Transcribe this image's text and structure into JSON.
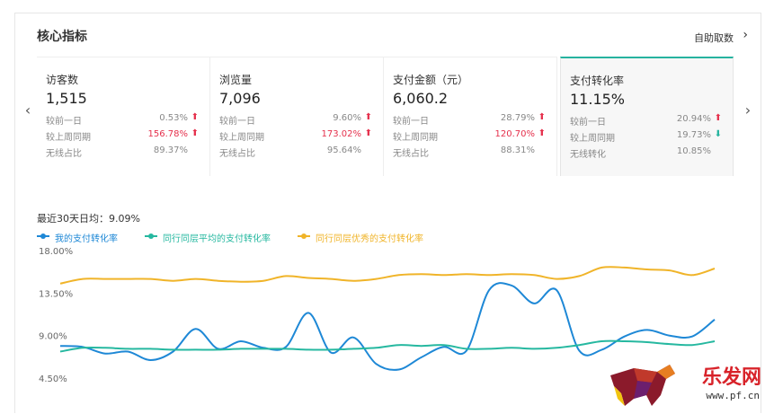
{
  "header": {
    "title": "核心指标",
    "self_fetch_label": "自助取数",
    "chevron_icon": "chevron-right-icon"
  },
  "nav": {
    "prev_icon": "chevron-left-icon",
    "next_icon": "chevron-right-icon",
    "prev_glyph": "‹",
    "next_glyph": "›"
  },
  "kpis": [
    {
      "name": "访客数",
      "value": "1,515",
      "rows": [
        {
          "label": "较前一日",
          "value": "0.53%",
          "trend": "up",
          "highlight": false
        },
        {
          "label": "较上周同期",
          "value": "156.78%",
          "trend": "up",
          "highlight": true
        },
        {
          "label": "无线占比",
          "value": "89.37%",
          "trend": "",
          "highlight": false
        }
      ]
    },
    {
      "name": "浏览量",
      "value": "7,096",
      "rows": [
        {
          "label": "较前一日",
          "value": "9.60%",
          "trend": "up",
          "highlight": false
        },
        {
          "label": "较上周同期",
          "value": "173.02%",
          "trend": "up",
          "highlight": true
        },
        {
          "label": "无线占比",
          "value": "95.64%",
          "trend": "",
          "highlight": false
        }
      ]
    },
    {
      "name": "支付金额（元）",
      "value": "6,060.2",
      "rows": [
        {
          "label": "较前一日",
          "value": "28.79%",
          "trend": "up",
          "highlight": false
        },
        {
          "label": "较上周同期",
          "value": "120.70%",
          "trend": "up",
          "highlight": true
        },
        {
          "label": "无线占比",
          "value": "88.31%",
          "trend": "",
          "highlight": false
        }
      ]
    },
    {
      "name": "支付转化率",
      "value": "11.15%",
      "active": true,
      "rows": [
        {
          "label": "较前一日",
          "value": "20.94%",
          "trend": "up",
          "highlight": false
        },
        {
          "label": "较上周同期",
          "value": "19.73%",
          "trend": "down",
          "highlight": false
        },
        {
          "label": "无线转化",
          "value": "10.85%",
          "trend": "",
          "highlight": false
        }
      ]
    }
  ],
  "colors": {
    "accent": "#26b39f",
    "up": "#e5304c",
    "down": "#26b39f",
    "mine": "#1e88d6",
    "avg": "#26b8a0",
    "top": "#f0b429"
  },
  "chart": {
    "avg_text": "最近30天日均：9.09%",
    "legend": [
      "我的支付转化率",
      "同行同层平均的支付转化率",
      "同行同层优秀的支付转化率"
    ]
  },
  "chart_data": {
    "type": "line",
    "x": [
      1,
      2,
      3,
      4,
      5,
      6,
      7,
      8,
      9,
      10,
      11,
      12,
      13,
      14,
      15,
      16,
      17,
      18,
      19,
      20,
      21,
      22,
      23,
      24,
      25,
      26,
      27,
      28,
      29,
      30
    ],
    "ylim": [
      4.5,
      18.0
    ],
    "yticks": [
      "18.00%",
      "13.50%",
      "9.00%",
      "4.50%"
    ],
    "grid": false,
    "series": [
      {
        "name": "我的支付转化率",
        "color": "#1e88d6",
        "values": [
          7.9,
          7.8,
          7.1,
          7.3,
          6.4,
          7.3,
          9.7,
          7.6,
          8.4,
          7.7,
          7.8,
          11.4,
          7.2,
          8.8,
          6.0,
          5.4,
          6.7,
          7.8,
          7.4,
          13.8,
          14.3,
          12.4,
          13.8,
          7.4,
          7.5,
          8.9,
          9.6,
          9.0,
          8.9,
          10.7
        ]
      },
      {
        "name": "同行同层平均的支付转化率",
        "color": "#26b8a0",
        "values": [
          7.3,
          7.7,
          7.7,
          7.6,
          7.6,
          7.5,
          7.5,
          7.5,
          7.6,
          7.6,
          7.6,
          7.5,
          7.5,
          7.6,
          7.7,
          8.0,
          7.9,
          8.0,
          7.6,
          7.6,
          7.7,
          7.6,
          7.7,
          8.0,
          8.4,
          8.4,
          8.3,
          8.1,
          8.0,
          8.4
        ]
      },
      {
        "name": "同行同层优秀的支付转化率",
        "color": "#f0b429",
        "values": [
          14.5,
          15.0,
          15.0,
          15.0,
          15.0,
          14.8,
          15.0,
          14.8,
          14.7,
          14.8,
          15.3,
          15.1,
          15.0,
          14.8,
          15.0,
          15.4,
          15.5,
          15.4,
          15.5,
          15.4,
          15.5,
          15.4,
          15.0,
          15.3,
          16.2,
          16.2,
          16.0,
          15.9,
          15.4,
          16.1
        ]
      }
    ]
  },
  "watermark": {
    "brand": "乐发网",
    "url": "www.pf.cn"
  }
}
